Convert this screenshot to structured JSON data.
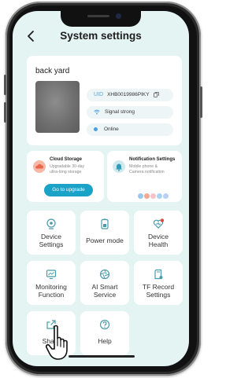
{
  "header": {
    "title": "System settings"
  },
  "device": {
    "name": "back yard",
    "uid_label": "UID",
    "uid_value": "XHB0019986PIKY",
    "signal_status": "Signal strong",
    "online_status": "Online"
  },
  "cloud": {
    "title": "Cloud Storage",
    "desc_line1": "Upgradable 30-day",
    "desc_line2": "ultra-long storage",
    "button": "Go to upgrade"
  },
  "notification": {
    "title": "Notification Settings",
    "desc_line1": "Mobile phone &",
    "desc_line2": "Camera notification"
  },
  "tiles": [
    {
      "line1": "Device",
      "line2": "Settings"
    },
    {
      "line1": "Power mode",
      "line2": ""
    },
    {
      "line1": "Device",
      "line2": "Health"
    },
    {
      "line1": "Monitoring",
      "line2": "Function"
    },
    {
      "line1": "AI Smart",
      "line2": "Service"
    },
    {
      "line1": "TF Record",
      "line2": "Settings"
    },
    {
      "line1": "Share",
      "line2": ""
    },
    {
      "line1": "Help",
      "line2": ""
    }
  ],
  "colors": {
    "screen_bg": "#e4f4f2",
    "accent": "#1aa2c7",
    "icon_teal": "#4a9aa8",
    "health_alert": "#e8453c"
  },
  "icons": {
    "back": "chevron-left-icon",
    "copy": "copy-icon",
    "signal": "wifi-icon",
    "online": "dot-icon",
    "cloud": "cloud-icon",
    "bell": "bell-icon",
    "device_settings": "camera-icon",
    "power": "battery-icon",
    "health": "heart-icon",
    "monitoring": "monitor-icon",
    "ai": "aperture-icon",
    "tf": "sd-card-icon",
    "share": "share-icon",
    "help": "help-circle-icon",
    "pointer": "hand-pointer-icon"
  }
}
